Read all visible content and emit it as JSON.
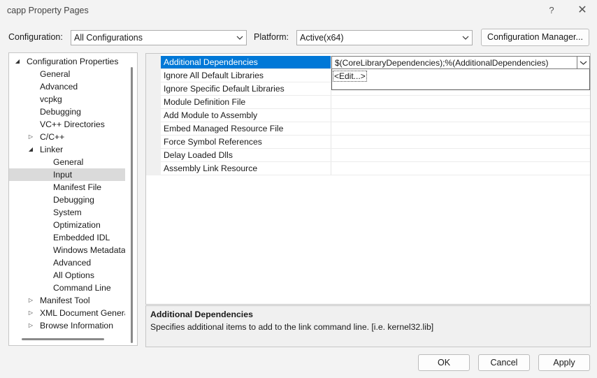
{
  "window": {
    "title": "capp Property Pages",
    "help_glyph": "?",
    "close_glyph": "✕"
  },
  "config_bar": {
    "configuration_label": "Configuration:",
    "configuration_value": "All Configurations",
    "platform_label": "Platform:",
    "platform_value": "Active(x64)",
    "manager_button": "Configuration Manager..."
  },
  "tree": {
    "items": [
      {
        "label": "Configuration Properties",
        "expander": "◢"
      },
      {
        "label": "General"
      },
      {
        "label": "Advanced"
      },
      {
        "label": "vcpkg"
      },
      {
        "label": "Debugging"
      },
      {
        "label": "VC++ Directories"
      },
      {
        "label": "C/C++",
        "expander": "▷"
      },
      {
        "label": "Linker",
        "expander": "◢"
      },
      {
        "label": "General"
      },
      {
        "label": "Input",
        "selected": true
      },
      {
        "label": "Manifest File"
      },
      {
        "label": "Debugging"
      },
      {
        "label": "System"
      },
      {
        "label": "Optimization"
      },
      {
        "label": "Embedded IDL"
      },
      {
        "label": "Windows Metadata"
      },
      {
        "label": "Advanced"
      },
      {
        "label": "All Options"
      },
      {
        "label": "Command Line"
      },
      {
        "label": "Manifest Tool",
        "expander": "▷"
      },
      {
        "label": "XML Document Generator",
        "expander": "▷"
      },
      {
        "label": "Browse Information",
        "expander": "▷"
      }
    ]
  },
  "grid": {
    "properties": [
      {
        "name": "Additional Dependencies",
        "selected": true
      },
      {
        "name": "Ignore All Default Libraries"
      },
      {
        "name": "Ignore Specific Default Libraries"
      },
      {
        "name": "Module Definition File"
      },
      {
        "name": "Add Module to Assembly"
      },
      {
        "name": "Embed Managed Resource File"
      },
      {
        "name": "Force Symbol References"
      },
      {
        "name": "Delay Loaded Dlls"
      },
      {
        "name": "Assembly Link Resource"
      }
    ],
    "editor_value": "$(CoreLibraryDependencies);%(AdditionalDependencies)",
    "dropdown_option": "<Edit...>"
  },
  "description": {
    "title": "Additional Dependencies",
    "text": "Specifies additional items to add to the link command line. [i.e. kernel32.lib]"
  },
  "buttons": {
    "ok": "OK",
    "cancel": "Cancel",
    "apply": "Apply"
  },
  "colors": {
    "selection_blue": "#0078d7",
    "tree_selected": "#dadada",
    "window_bg": "#f3f3f3"
  }
}
